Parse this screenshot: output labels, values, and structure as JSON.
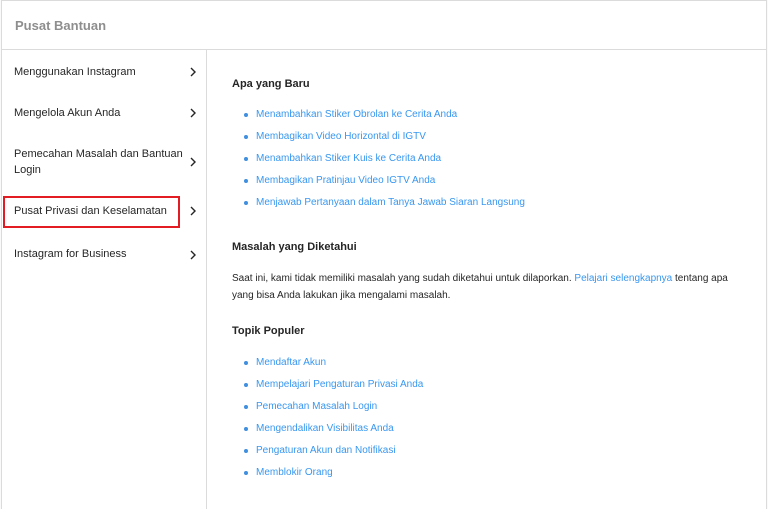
{
  "header": {
    "title": "Pusat Bantuan"
  },
  "sidebar": {
    "items": [
      {
        "label": "Menggunakan Instagram"
      },
      {
        "label": "Mengelola Akun Anda"
      },
      {
        "label_line1": "Pemecahan Masalah dan Bantuan",
        "label_line2": "Login"
      },
      {
        "label": "Pusat Privasi dan Keselamatan",
        "highlighted": true
      },
      {
        "label": "Instagram for Business"
      }
    ],
    "chevron_icon": "chevron-right-icon"
  },
  "main": {
    "whats_new": {
      "title": "Apa yang Baru",
      "links": [
        "Menambahkan Stiker Obrolan ke Cerita Anda",
        "Membagikan Video Horizontal di IGTV",
        "Menambahkan Stiker Kuis ke Cerita Anda",
        "Membagikan Pratinjau Video IGTV Anda",
        "Menjawab Pertanyaan dalam Tanya Jawab Siaran Langsung"
      ]
    },
    "known_issues": {
      "title": "Masalah yang Diketahui",
      "text_before": "Saat ini, kami tidak memiliki masalah yang sudah diketahui untuk dilaporkan. ",
      "link": "Pelajari selengkapnya",
      "text_after": " tentang apa yang bisa Anda lakukan jika mengalami masalah."
    },
    "popular_topics": {
      "title": "Topik Populer",
      "links": [
        "Mendaftar Akun",
        "Mempelajari Pengaturan Privasi Anda",
        "Pemecahan Masalah Login",
        "Mengendalikan Visibilitas Anda",
        "Pengaturan Akun dan Notifikasi",
        "Memblokir Orang"
      ]
    }
  },
  "colors": {
    "link": "#3897f0",
    "highlight": "#e31b23",
    "border": "#dbdbdb"
  }
}
